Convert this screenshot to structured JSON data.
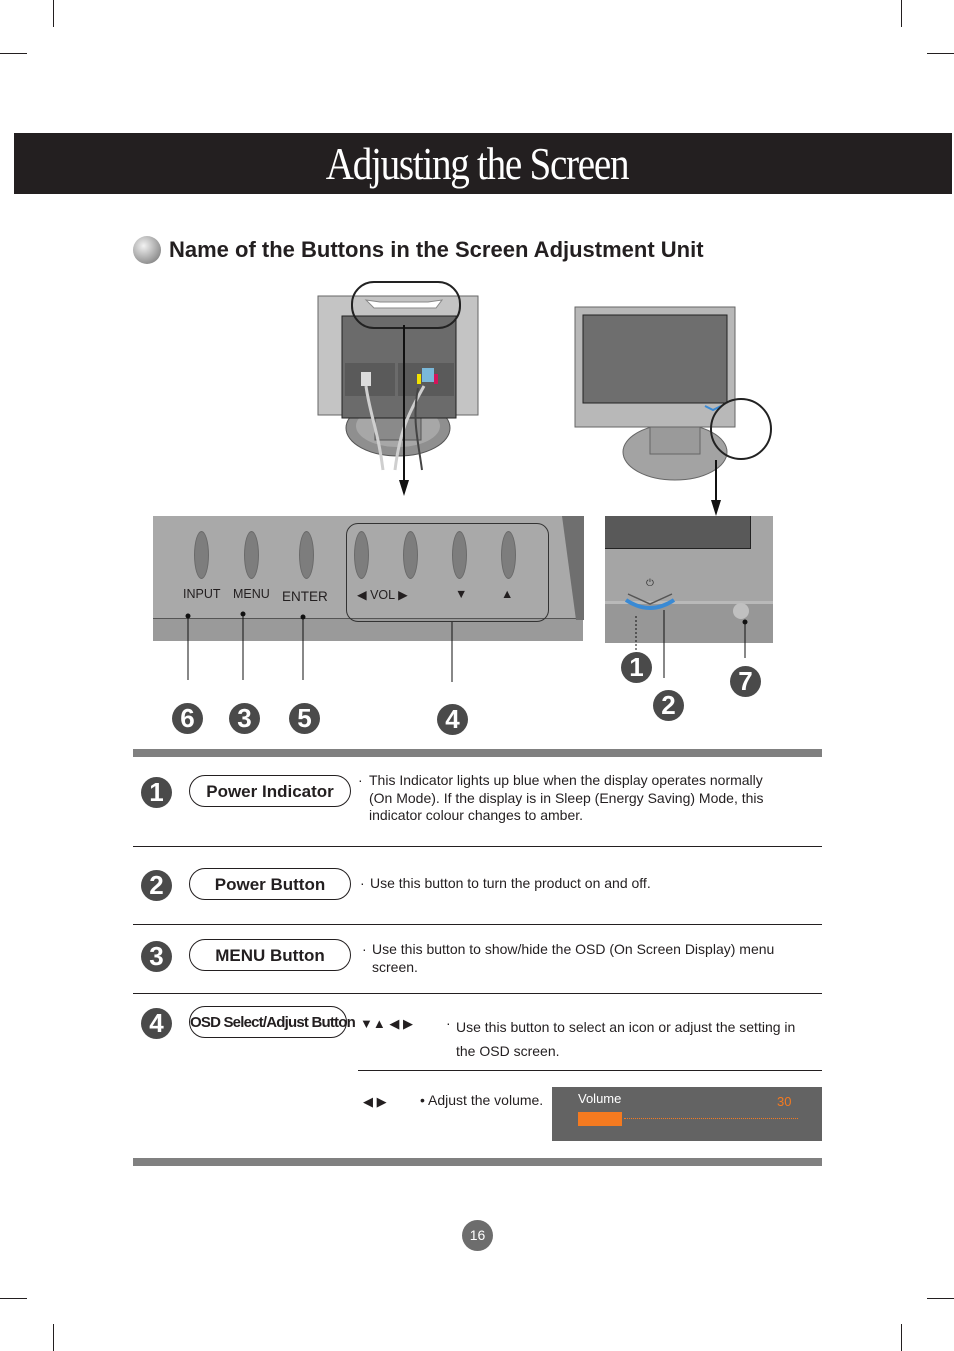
{
  "page": {
    "title": "Adjusting the Screen",
    "section_title": "Name of the Buttons in the Screen Adjustment Unit",
    "page_number": "16"
  },
  "diagram": {
    "rear_panel_labels": {
      "input": "INPUT",
      "menu": "MENU",
      "enter": "ENTER",
      "vol": "◀ VOL ▶",
      "down": "▼",
      "up": "▲"
    },
    "callouts": [
      "6",
      "3",
      "5",
      "4",
      "1",
      "2",
      "7"
    ],
    "power_symbol": "⏻"
  },
  "items": [
    {
      "number": "1",
      "name": "Power Indicator",
      "description": "This Indicator lights up blue when the display operates normally (On Mode). If the display is in Sleep (Energy Saving) Mode, this indicator colour changes to amber."
    },
    {
      "number": "2",
      "name": "Power Button",
      "description": "Use this button to turn the product on and off."
    },
    {
      "number": "3",
      "name": "MENU Button",
      "description": "Use this button to show/hide the OSD (On Screen Display) menu screen."
    },
    {
      "number": "4",
      "name": "OSD Select/Adjust Button",
      "arrows": "▼▲ ◀ ▶",
      "description": "Use this button to select an icon or adjust the setting in the OSD screen.",
      "sub": {
        "arrows": "◀ ▶",
        "description": "• Adjust the volume.",
        "osd": {
          "label": "Volume",
          "value": "30",
          "level_percent": 30,
          "accent": "#f47a20"
        }
      }
    }
  ],
  "bullet": "·"
}
